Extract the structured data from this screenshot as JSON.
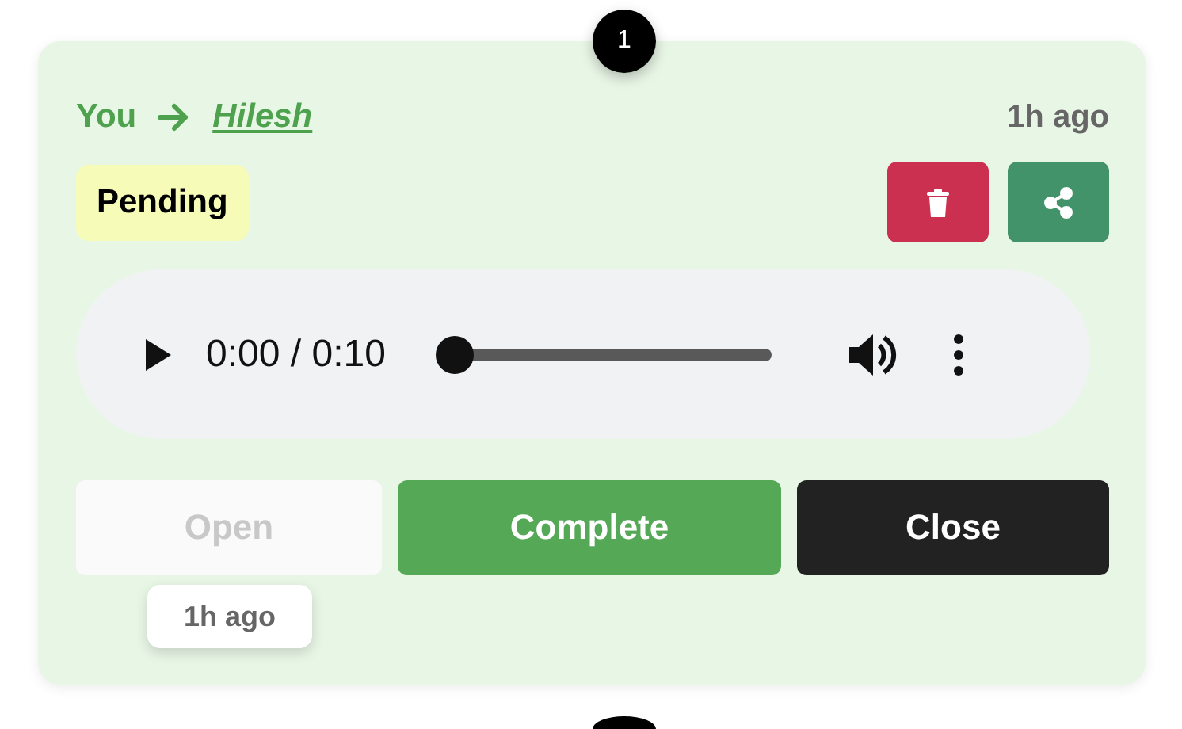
{
  "step_badge": "1",
  "header": {
    "sender": "You",
    "recipient": "Hilesh",
    "time": "1h ago"
  },
  "status": {
    "label": "Pending"
  },
  "actions": [
    {
      "kind": "delete"
    },
    {
      "kind": "share"
    }
  ],
  "player": {
    "time": "0:00 / 0:10",
    "level": 0
  },
  "buttons": [
    {
      "label": "Open",
      "kind": "plain",
      "disabled": true
    },
    {
      "label": "Complete",
      "kind": "success",
      "disabled": false
    },
    {
      "label": "Close",
      "kind": "dark",
      "disabled": false
    }
  ],
  "tooltip": "1h ago"
}
